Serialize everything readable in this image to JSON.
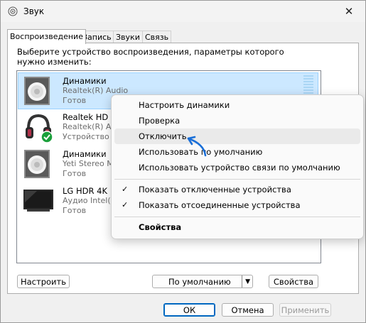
{
  "window": {
    "title": "Звук",
    "close_glyph": "✕"
  },
  "tabs": [
    {
      "label": "Воспроизведение",
      "active": true
    },
    {
      "label": "Запись"
    },
    {
      "label": "Звуки"
    },
    {
      "label": "Связь"
    }
  ],
  "panel": {
    "description": "Выберите устройство воспроизведения, параметры которого нужно изменить:"
  },
  "devices": [
    {
      "name": "Динамики",
      "driver": "Realtek(R) Audio",
      "status": "Готов",
      "icon": "speaker-icon",
      "selected": true
    },
    {
      "name": "Realtek HD A",
      "driver": "Realtek(R) Audio",
      "status": "Устройство п",
      "icon": "headphones-icon",
      "default": true
    },
    {
      "name": "Динамики",
      "driver": "Yeti Stereo M",
      "status": "Готов",
      "icon": "speaker-icon"
    },
    {
      "name": "LG HDR 4K",
      "driver": "Аудио Intel(R",
      "status": "Готов",
      "icon": "monitor-icon"
    }
  ],
  "buttons": {
    "configure": "Настроить",
    "default": "По умолчанию",
    "properties": "Свойства",
    "ok": "ОК",
    "cancel": "Отмена",
    "apply": "Применить"
  },
  "context_menu": {
    "items": [
      {
        "label": "Настроить динамики"
      },
      {
        "label": "Проверка"
      },
      {
        "label": "Отключить",
        "hovered": true
      },
      {
        "label": "Использовать по умолчанию"
      },
      {
        "label": "Использовать устройство связи по умолчанию"
      },
      {
        "label": "Показать отключенные устройства",
        "checked": true
      },
      {
        "label": "Показать отсоединенные устройства",
        "checked": true
      },
      {
        "label": "Свойства",
        "bold": true
      }
    ],
    "check_glyph": "✓"
  },
  "colors": {
    "selection": "#cce8ff",
    "accent": "#0067c0",
    "arrow": "#1a6fd8",
    "badge": "#1a9f3a"
  }
}
